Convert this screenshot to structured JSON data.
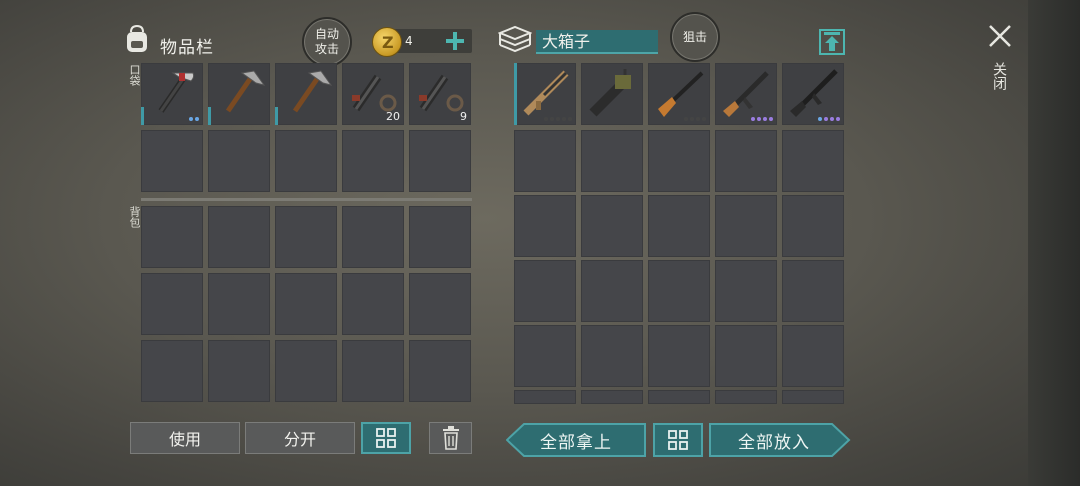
{
  "inventory": {
    "title": "物品栏",
    "auto_attack": "自动攻击",
    "coin_count": "4",
    "pocket_label": "口袋",
    "backpack_label": "背包",
    "pocket_qty": [
      "",
      "",
      "",
      "20",
      "9"
    ]
  },
  "container": {
    "title": "大箱子",
    "mode_label": "狙击"
  },
  "close_label": "关闭",
  "buttons": {
    "use": "使用",
    "split": "分开",
    "take_all": "全部拿上",
    "put_all": "全部放入"
  },
  "colors": {
    "accent_teal": "#2e6d71",
    "rarity_purple": "#9a7de0",
    "rarity_blue": "#6aa7e6"
  },
  "icons": {
    "backpack": "backpack-icon",
    "coin": "coin-icon",
    "plus": "plus-icon",
    "box": "box-stack-icon",
    "upload": "upload-icon",
    "close": "close-icon",
    "grid": "grid-sort-icon",
    "trash": "trash-icon"
  }
}
